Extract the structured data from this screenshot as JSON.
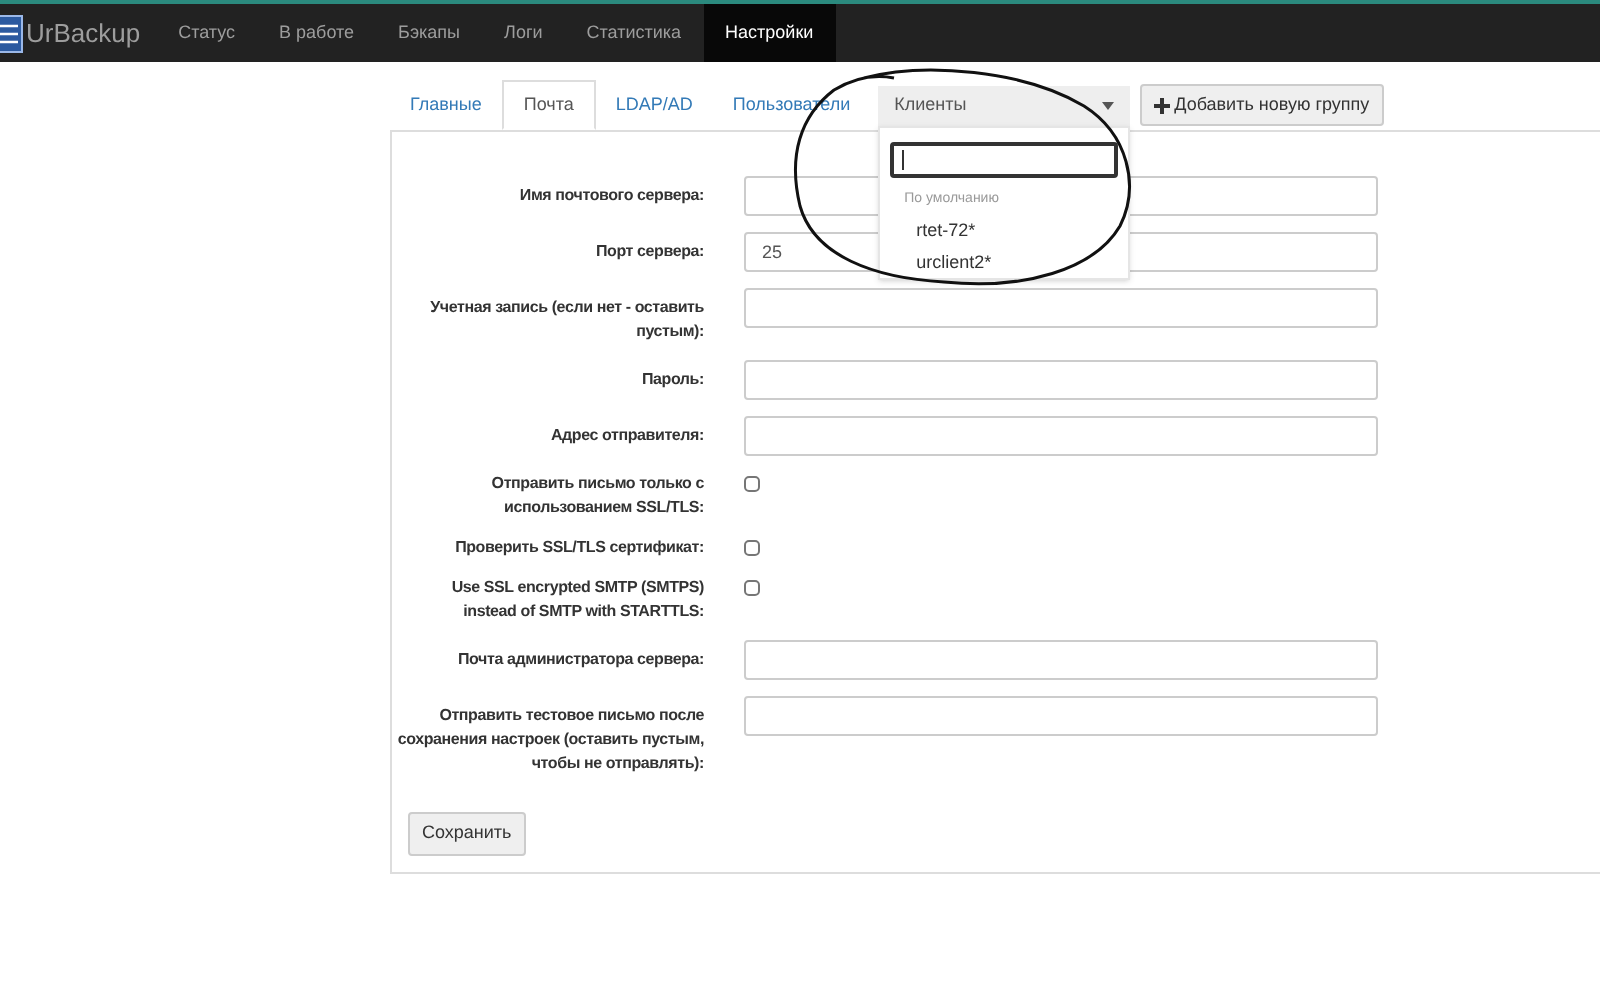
{
  "navbar": {
    "brand": "UrBackup",
    "items": [
      {
        "label": "Статус",
        "selected": false
      },
      {
        "label": "В работе",
        "selected": false
      },
      {
        "label": "Бэкапы",
        "selected": false
      },
      {
        "label": "Логи",
        "selected": false
      },
      {
        "label": "Статистика",
        "selected": false
      },
      {
        "label": "Настройки",
        "selected": true
      }
    ]
  },
  "tabs": [
    {
      "label": "Главные",
      "selected": false
    },
    {
      "label": "Почта",
      "selected": true
    },
    {
      "label": "LDAP/AD",
      "selected": false
    },
    {
      "label": "Пользователи",
      "selected": false
    }
  ],
  "group_select": {
    "value": "Клиенты",
    "expanded": true,
    "menu": {
      "group_header": "По умолчанию",
      "items": [
        "rtet-72*",
        "urclient2*"
      ]
    }
  },
  "add_group_button": "Добавить новую группу",
  "form": {
    "fields": [
      {
        "kind": "input",
        "label": "Имя почтового сервера:"
      },
      {
        "kind": "input",
        "label": "Порт сервера:",
        "value": "25"
      },
      {
        "kind": "input",
        "label": "Учетная запись (если нет - оставить пустым):"
      },
      {
        "kind": "input",
        "label": "Пароль:"
      },
      {
        "kind": "input",
        "label": "Адрес отправителя:"
      },
      {
        "kind": "checkbox",
        "label": "Отправить письмо только с использованием SSL/TLS:",
        "checked": false
      },
      {
        "kind": "checkbox",
        "label": "Проверить SSL/TLS сертификат:",
        "checked": false
      },
      {
        "kind": "checkbox",
        "label": "Use SSL encrypted SMTP (SMTPS) instead of SMTP with STARTTLS:",
        "checked": false
      },
      {
        "kind": "input",
        "label": "Почта администратора сервера:"
      },
      {
        "kind": "input",
        "label": "Отправить тестовое письмо после сохранения настроек (оставить пустым, чтобы не отправлять):"
      }
    ],
    "save_button": "Сохранить"
  }
}
